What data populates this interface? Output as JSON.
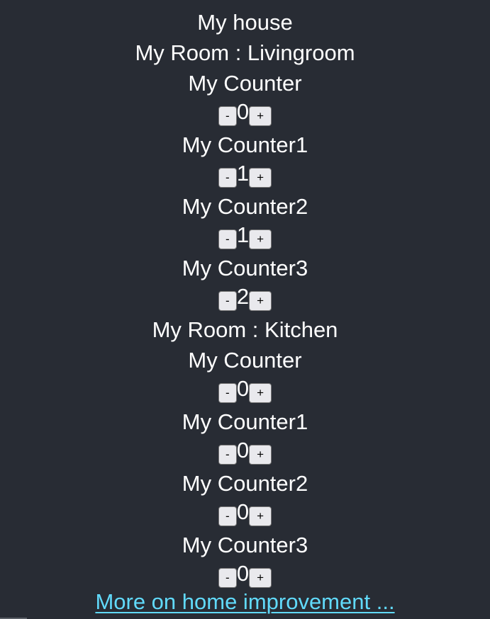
{
  "house": {
    "title": "My house"
  },
  "rooms": [
    {
      "label": "My Room : Livingroom",
      "counters": [
        {
          "label": "My Counter",
          "value": "0"
        },
        {
          "label": "My Counter1",
          "value": "1"
        },
        {
          "label": "My Counter2",
          "value": "1"
        },
        {
          "label": "My Counter3",
          "value": "2"
        }
      ]
    },
    {
      "label": "My Room : Kitchen",
      "counters": [
        {
          "label": "My Counter",
          "value": "0"
        },
        {
          "label": "My Counter1",
          "value": "0"
        },
        {
          "label": "My Counter2",
          "value": "0"
        },
        {
          "label": "My Counter3",
          "value": "0"
        }
      ]
    }
  ],
  "controls": {
    "decrement_label": "-",
    "increment_label": "+"
  },
  "footer": {
    "link_text": "More on home improvement ..."
  },
  "colors": {
    "background": "#282c34",
    "text": "#ffffff",
    "link": "#61dafb",
    "button_bg": "#e9e9ed"
  }
}
